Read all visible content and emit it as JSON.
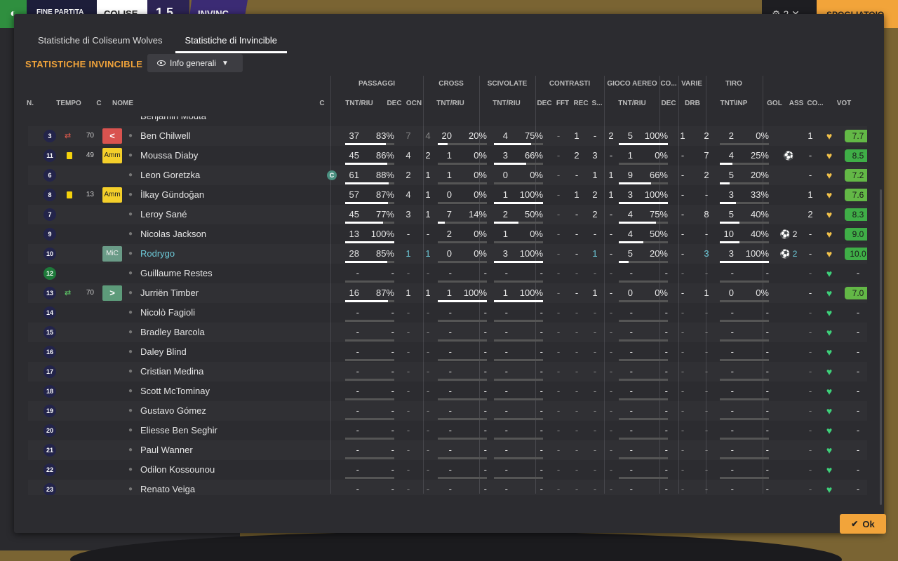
{
  "topbar": {
    "status": "FINE PARTITA",
    "home": "COLISE",
    "score": "1 5",
    "away": "INVINC",
    "controls": "⚙ 2  ✕",
    "continue": "SPOGLIATOIO"
  },
  "tabs": [
    "Statistiche di Coliseum Wolves",
    "Statistiche di Invincible"
  ],
  "heading": "STATISTICHE INVINCIBLE",
  "view_select": "Info generali",
  "groups": {
    "passaggi": "PASSAGGI",
    "cross": "CROSS",
    "scivolate": "SCIVOLATE",
    "contrasti": "CONTRASTI",
    "gioco_aereo": "GIOCO AEREO",
    "co": "CO...",
    "varie": "VARIE",
    "tiro": "TIRO"
  },
  "headers": {
    "n": "N.",
    "tempo": "TEMPO",
    "c": "C",
    "nome": "NOME",
    "cap": "C",
    "pass_tnt": "TNT/RIU",
    "pass_dec": "DEC",
    "pass_ocn": "OCN",
    "cross_tnt": "TNT/RIU",
    "sciv_tnt": "TNT/RIU",
    "con_dec": "DEC",
    "con_fft": "FFT",
    "con_rec": "REC",
    "con_s": "S...",
    "aereo_tnt": "TNT/RIU",
    "co_dec": "DEC",
    "varie_drb": "DRB",
    "tiro_tnt": "TNT\\INP",
    "gol": "GOL",
    "ass": "ASS",
    "co2": "CO...",
    "vot": "VOT"
  },
  "cut_row_name": "Benjamin Mouta",
  "players": [
    {
      "num": "3",
      "sub": "out",
      "minute": "70",
      "role": "out",
      "role_label": "<",
      "name": "Ben Chilwell",
      "p_tnt": "37",
      "p_pct": "83%",
      "p_fill": 0.83,
      "p_dec": "7",
      "p_ocn": "4",
      "dimdec": true,
      "c_tnt": "20",
      "c_pct": "20%",
      "c_fill": 0.2,
      "s_tnt": "4",
      "s_pct": "75%",
      "s_fill": 0.75,
      "k1": "-",
      "k2": "1",
      "k3": "-",
      "k4": "2",
      "a_tnt": "5",
      "a_pct": "100%",
      "a_fill": 1.0,
      "co": "1",
      "drb": "2",
      "t_tnt": "2",
      "t_pct": "0%",
      "t_fill": 0.0,
      "gol": "",
      "ass": "1",
      "heart": "y",
      "rating": "7.7",
      "rgrade": "g1"
    },
    {
      "num": "11",
      "yellow": true,
      "minute": "49",
      "role": "amm",
      "role_label": "Amm",
      "name": "Moussa Diaby",
      "p_tnt": "45",
      "p_pct": "86%",
      "p_fill": 0.86,
      "p_dec": "4",
      "p_ocn": "2",
      "c_tnt": "1",
      "c_pct": "0%",
      "c_fill": 0.0,
      "s_tnt": "3",
      "s_pct": "66%",
      "s_fill": 0.66,
      "k1": "-",
      "k2": "2",
      "k3": "3",
      "k4": "-",
      "a_tnt": "1",
      "a_pct": "0%",
      "a_fill": 0.0,
      "co": "-",
      "drb": "7",
      "t_tnt": "4",
      "t_pct": "25%",
      "t_fill": 0.25,
      "gol": "⚽",
      "ass": "-",
      "heart": "y",
      "rating": "8.5",
      "rgrade": "g2"
    },
    {
      "num": "6",
      "name": "Leon Goretzka",
      "captain": "C",
      "p_tnt": "61",
      "p_pct": "88%",
      "p_fill": 0.88,
      "p_dec": "2",
      "p_ocn": "1",
      "c_tnt": "1",
      "c_pct": "0%",
      "c_fill": 0.0,
      "s_tnt": "0",
      "s_pct": "0%",
      "s_fill": 0.0,
      "k1": "-",
      "k2": "-",
      "k3": "1",
      "k4": "1",
      "a_tnt": "9",
      "a_pct": "66%",
      "a_fill": 0.66,
      "co": "-",
      "drb": "2",
      "t_tnt": "5",
      "t_pct": "20%",
      "t_fill": 0.2,
      "gol": "",
      "ass": "-",
      "heart": "y",
      "rating": "7.2",
      "rgrade": "g1"
    },
    {
      "num": "8",
      "yellow": true,
      "minute": "13",
      "role": "amm",
      "role_label": "Amm",
      "name": "İlkay Gündoğan",
      "p_tnt": "57",
      "p_pct": "87%",
      "p_fill": 0.87,
      "p_dec": "4",
      "p_ocn": "1",
      "c_tnt": "0",
      "c_pct": "0%",
      "c_fill": 0.0,
      "s_tnt": "1",
      "s_pct": "100%",
      "s_fill": 1.0,
      "k1": "-",
      "k2": "1",
      "k3": "2",
      "k4": "1",
      "a_tnt": "3",
      "a_pct": "100%",
      "a_fill": 1.0,
      "co": "-",
      "drb": "-",
      "t_tnt": "3",
      "t_pct": "33%",
      "t_fill": 0.33,
      "gol": "",
      "ass": "1",
      "heart": "y",
      "rating": "7.6",
      "rgrade": "g1"
    },
    {
      "num": "7",
      "name": "Leroy Sané",
      "p_tnt": "45",
      "p_pct": "77%",
      "p_fill": 0.77,
      "p_dec": "3",
      "p_ocn": "1",
      "c_tnt": "7",
      "c_pct": "14%",
      "c_fill": 0.14,
      "s_tnt": "2",
      "s_pct": "50%",
      "s_fill": 0.5,
      "k1": "-",
      "k2": "-",
      "k3": "2",
      "k4": "-",
      "a_tnt": "4",
      "a_pct": "75%",
      "a_fill": 0.75,
      "co": "-",
      "drb": "8",
      "t_tnt": "5",
      "t_pct": "40%",
      "t_fill": 0.4,
      "gol": "",
      "ass": "2",
      "heart": "y",
      "rating": "8.3",
      "rgrade": "g2"
    },
    {
      "num": "9",
      "name": "Nicolas Jackson",
      "p_tnt": "13",
      "p_pct": "100%",
      "p_fill": 1.0,
      "p_dec": "-",
      "p_ocn": "-",
      "c_tnt": "2",
      "c_pct": "0%",
      "c_fill": 0.0,
      "s_tnt": "1",
      "s_pct": "0%",
      "s_fill": 0.0,
      "k1": "-",
      "k2": "-",
      "k3": "-",
      "k4": "-",
      "a_tnt": "4",
      "a_pct": "50%",
      "a_fill": 0.5,
      "co": "-",
      "drb": "-",
      "t_tnt": "10",
      "t_pct": "40%",
      "t_fill": 0.4,
      "gol": "⚽ 2",
      "ass": "-",
      "heart": "y",
      "rating": "9.0",
      "rgrade": "g2"
    },
    {
      "num": "10",
      "role": "mc",
      "role_label": "MiC",
      "name": "Rodrygo",
      "highlight": true,
      "p_tnt": "28",
      "p_pct": "85%",
      "p_fill": 0.85,
      "p_dec": "1",
      "p_ocn": "1",
      "c_tnt": "0",
      "c_pct": "0%",
      "c_fill": 0.0,
      "s_tnt": "3",
      "s_pct": "100%",
      "s_fill": 1.0,
      "k1": "-",
      "k2": "-",
      "k3": "1",
      "k4": "-",
      "a_tnt": "5",
      "a_pct": "20%",
      "a_fill": 0.2,
      "co": "-",
      "drb": "3",
      "t_tnt": "3",
      "t_pct": "100%",
      "t_fill": 1.0,
      "gol": "⚽ 2",
      "ass": "-",
      "heart": "y",
      "rating": "10.0",
      "rgrade": "g2"
    },
    {
      "num": "12",
      "gk": true,
      "name": "Guillaume Restes",
      "empty": true
    },
    {
      "num": "13",
      "sub": "in",
      "minute": "70",
      "role": "in",
      "role_label": ">",
      "name": "Jurriën Timber",
      "p_tnt": "16",
      "p_pct": "87%",
      "p_fill": 0.87,
      "p_dec": "1",
      "p_ocn": "1",
      "c_tnt": "1",
      "c_pct": "100%",
      "c_fill": 1.0,
      "s_tnt": "1",
      "s_pct": "100%",
      "s_fill": 1.0,
      "k1": "-",
      "k2": "-",
      "k3": "1",
      "k4": "-",
      "a_tnt": "0",
      "a_pct": "0%",
      "a_fill": 0.0,
      "co": "-",
      "drb": "1",
      "t_tnt": "0",
      "t_pct": "0%",
      "t_fill": 0.0,
      "gol": "",
      "ass": "-",
      "heart": "g",
      "rating": "7.0",
      "rgrade": "g1"
    },
    {
      "num": "14",
      "name": "Nicolò Fagioli",
      "empty": true
    },
    {
      "num": "15",
      "name": "Bradley Barcola",
      "empty": true
    },
    {
      "num": "16",
      "name": "Daley Blind",
      "empty": true
    },
    {
      "num": "17",
      "name": "Cristian Medina",
      "empty": true
    },
    {
      "num": "18",
      "name": "Scott McTominay",
      "empty": true
    },
    {
      "num": "19",
      "name": "Gustavo Gómez",
      "empty": true
    },
    {
      "num": "20",
      "name": "Eliesse Ben Seghir",
      "empty": true
    },
    {
      "num": "21",
      "name": "Paul Wanner",
      "empty": true
    },
    {
      "num": "22",
      "name": "Odilon Kossounou",
      "empty": true
    },
    {
      "num": "23",
      "name": "Renato Veiga",
      "empty": true
    }
  ],
  "ok_label": "Ok",
  "colors": {
    "accent": "#f2a43a",
    "panel": "#2c2c30",
    "rating": "#63b846",
    "heart_green": "#3ed17a"
  }
}
